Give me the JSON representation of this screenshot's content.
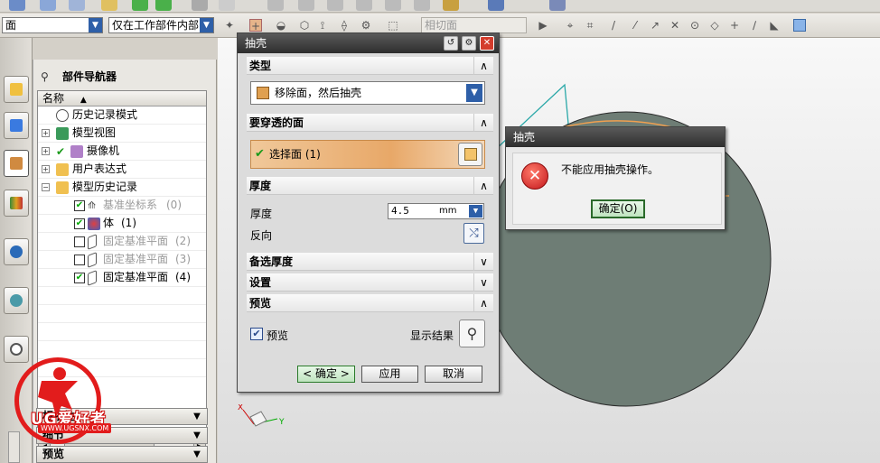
{
  "toolbar": {
    "filter_value": "面",
    "scope_value": "仅在工作部件内部",
    "snap_value": "相切面"
  },
  "navigator": {
    "title": "部件导航器",
    "column_header": "名称",
    "rows": [
      {
        "label": "历史记录模式",
        "count": ""
      },
      {
        "label": "模型视图",
        "count": ""
      },
      {
        "label": "摄像机",
        "count": ""
      },
      {
        "label": "用户表达式",
        "count": ""
      },
      {
        "label": "模型历史记录",
        "count": ""
      },
      {
        "label": "基准坐标系",
        "count": "(0)"
      },
      {
        "label": "体",
        "count": "(1)"
      },
      {
        "label": "固定基准平面",
        "count": "(2)"
      },
      {
        "label": "固定基准平面",
        "count": "(3)"
      },
      {
        "label": "固定基准平面",
        "count": "(4)"
      }
    ],
    "panels": [
      "相依性",
      "细节",
      "预览"
    ]
  },
  "dialog": {
    "title": "抽壳",
    "sec_type": "类型",
    "type_value": "移除面，然后抽壳",
    "sec_faces": "要穿透的面",
    "select_face": "选择面 (1)",
    "sec_thickness": "厚度",
    "thickness_label": "厚度",
    "thickness_value": "4.5",
    "thickness_unit": "mm",
    "reverse_label": "反向",
    "sec_alt": "备选厚度",
    "sec_settings": "设置",
    "sec_preview": "预览",
    "preview_label": "预览",
    "show_result_label": "显示结果",
    "ok_label": "< 确定 >",
    "apply_label": "应用",
    "cancel_label": "取消"
  },
  "error": {
    "title": "抽壳",
    "message": "不能应用抽壳操作。",
    "ok_label": "确定(O)"
  },
  "triad": {
    "x": "X",
    "y": "Y"
  },
  "watermark": {
    "brand": "UG爱好者",
    "url": "WWW.UGSNX.COM"
  },
  "colors": {
    "model_fill": "#6e7d75",
    "model_edge": "#f0a050",
    "selection_bar": "#e8a868",
    "title_bar": "#3c3c3c",
    "error_red": "#c3171b"
  }
}
